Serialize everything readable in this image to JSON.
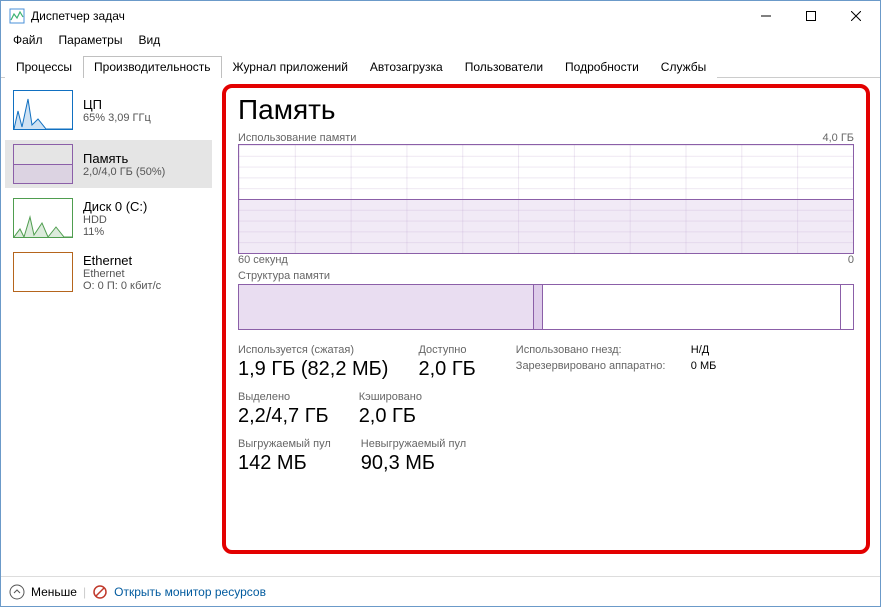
{
  "window": {
    "title": "Диспетчер задач"
  },
  "menu": {
    "file": "Файл",
    "options": "Параметры",
    "view": "Вид"
  },
  "tabs": {
    "processes": "Процессы",
    "performance": "Производительность",
    "apphistory": "Журнал приложений",
    "startup": "Автозагрузка",
    "users": "Пользователи",
    "details": "Подробности",
    "services": "Службы"
  },
  "sidebar": {
    "cpu": {
      "title": "ЦП",
      "sub": "65% 3,09 ГГц"
    },
    "memory": {
      "title": "Память",
      "sub": "2,0/4,0 ГБ (50%)"
    },
    "disk": {
      "title": "Диск 0 (C:)",
      "sub1": "HDD",
      "sub2": "11%"
    },
    "eth": {
      "title": "Ethernet",
      "sub1": "Ethernet",
      "sub2": "О: 0 П: 0 кбит/с"
    }
  },
  "main": {
    "title": "Память",
    "usage_label": "Использование памяти",
    "usage_max": "4,0 ГБ",
    "axis_left": "60 секунд",
    "axis_right": "0",
    "composition_label": "Структура памяти",
    "stats": {
      "in_use_label": "Используется (сжатая)",
      "in_use_value": "1,9 ГБ (82,2 МБ)",
      "available_label": "Доступно",
      "available_value": "2,0 ГБ",
      "committed_label": "Выделено",
      "committed_value": "2,2/4,7 ГБ",
      "cached_label": "Кэшировано",
      "cached_value": "2,0 ГБ",
      "paged_label": "Выгружаемый пул",
      "paged_value": "142 МБ",
      "nonpaged_label": "Невыгружаемый пул",
      "nonpaged_value": "90,3 МБ",
      "slots_label": "Использовано гнезд:",
      "slots_value": "Н/Д",
      "hw_reserved_label": "Зарезервировано аппаратно:",
      "hw_reserved_value": "0 МБ"
    }
  },
  "footer": {
    "fewer": "Меньше",
    "open_rm": "Открыть монитор ресурсов"
  },
  "chart_data": {
    "type": "area",
    "title": "Использование памяти",
    "xlabel": "60 секунд",
    "ylabel": "ГБ",
    "ylim": [
      0,
      4.0
    ],
    "x": [
      60,
      55,
      50,
      45,
      40,
      35,
      30,
      25,
      20,
      15,
      10,
      5,
      0
    ],
    "series": [
      {
        "name": "Память",
        "values": [
          2.0,
          2.0,
          2.0,
          2.0,
          2.0,
          2.05,
          2.0,
          2.0,
          2.0,
          2.0,
          2.0,
          2.0,
          2.0
        ]
      }
    ]
  }
}
